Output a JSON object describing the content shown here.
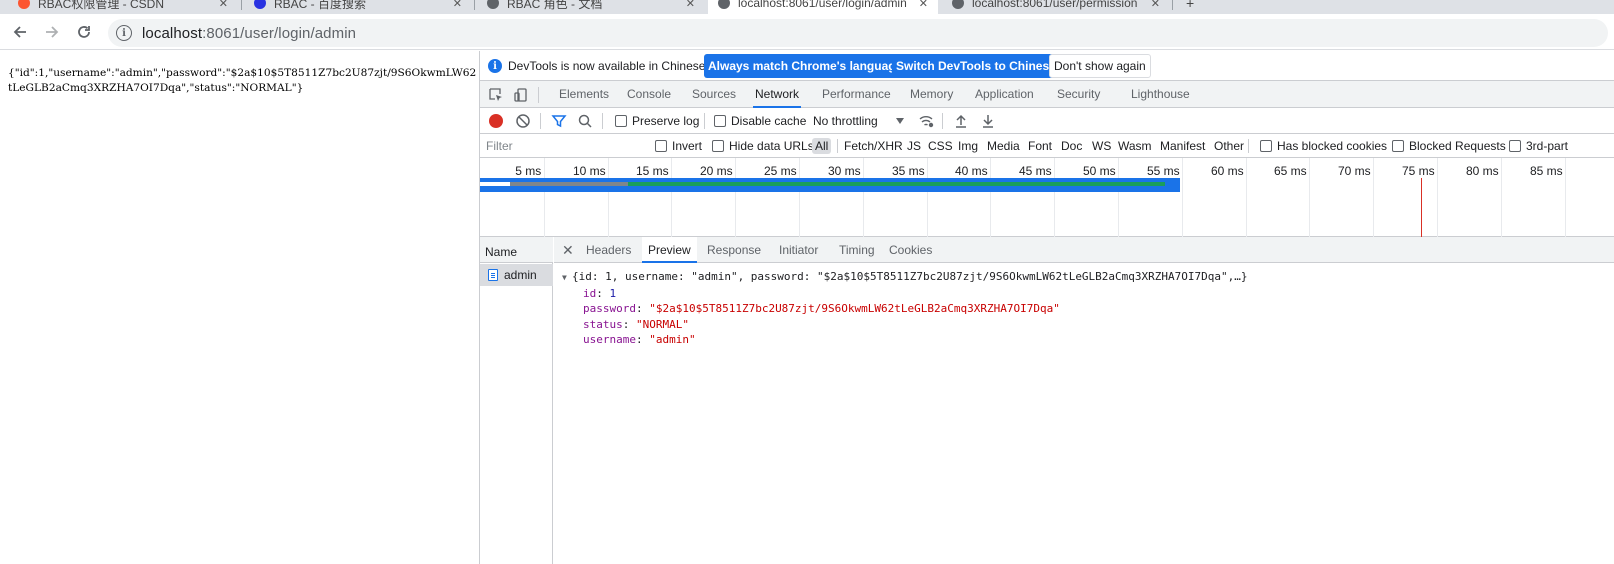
{
  "browser": {
    "tabs": [
      {
        "title": "RBAC权限管理 - CSDN",
        "active": false
      },
      {
        "title": "RBAC - 百度搜索",
        "active": false
      },
      {
        "title": "RBAC 角色 - 文档",
        "active": false
      },
      {
        "title": "localhost:8061/user/login/admin",
        "active": true
      },
      {
        "title": "localhost:8061/user/permission",
        "active": false
      }
    ],
    "url_host": "localhost",
    "url_path": ":8061/user/login/admin"
  },
  "page": {
    "body_text": "{\"id\":1,\"username\":\"admin\",\"password\":\"$2a$10$5T8511Z7bc2U87zjt/9S6OkwmLW62tLeGLB2aCmq3XRZHA7OI7Dqa\",\"status\":\"NORMAL\"}"
  },
  "devtools": {
    "infobar": {
      "message": "DevTools is now available in Chinese!",
      "btn_match": "Always match Chrome's language",
      "btn_switch": "Switch DevTools to Chinese",
      "btn_dismiss": "Don't show again"
    },
    "panels": [
      "Elements",
      "Console",
      "Sources",
      "Network",
      "Performance",
      "Memory",
      "Application",
      "Security",
      "Lighthouse"
    ],
    "active_panel": "Network",
    "network_toolbar": {
      "preserve_log": "Preserve log",
      "disable_cache": "Disable cache",
      "throttling": "No throttling"
    },
    "filter": {
      "placeholder": "Filter",
      "invert": "Invert",
      "hide_data_urls": "Hide data URLs",
      "types": [
        "All",
        "Fetch/XHR",
        "JS",
        "CSS",
        "Img",
        "Media",
        "Font",
        "Doc",
        "WS",
        "Wasm",
        "Manifest",
        "Other"
      ],
      "active_type": "All",
      "has_blocked_cookies": "Has blocked cookies",
      "blocked_requests": "Blocked Requests",
      "third_party": "3rd-part"
    },
    "timeline_ticks": [
      "5 ms",
      "10 ms",
      "15 ms",
      "20 ms",
      "25 ms",
      "30 ms",
      "35 ms",
      "40 ms",
      "45 ms",
      "50 ms",
      "55 ms",
      "60 ms",
      "65 ms",
      "70 ms",
      "75 ms",
      "80 ms",
      "85 ms"
    ],
    "timeline_colors": {
      "waiting": "#1a9e5a",
      "queued": "#80868b",
      "download": "#1a73e8",
      "load_marker": "#d93025"
    },
    "name_column_header": "Name",
    "requests": [
      {
        "name": "admin"
      }
    ],
    "detail_tabs": [
      "Headers",
      "Preview",
      "Response",
      "Initiator",
      "Timing",
      "Cookies"
    ],
    "active_detail_tab": "Preview",
    "preview": {
      "summary": "{id: 1, username: \"admin\", password: \"$2a$10$5T8511Z7bc2U87zjt/9S6OkwmLW62tLeGLB2aCmq3XRZHA7OI7Dqa\",…}",
      "fields": [
        {
          "key": "id",
          "value": "1",
          "type": "num"
        },
        {
          "key": "password",
          "value": "\"$2a$10$5T8511Z7bc2U87zjt/9S6OkwmLW62tLeGLB2aCmq3XRZHA7OI7Dqa\"",
          "type": "str"
        },
        {
          "key": "status",
          "value": "\"NORMAL\"",
          "type": "str"
        },
        {
          "key": "username",
          "value": "\"admin\"",
          "type": "str"
        }
      ]
    }
  }
}
